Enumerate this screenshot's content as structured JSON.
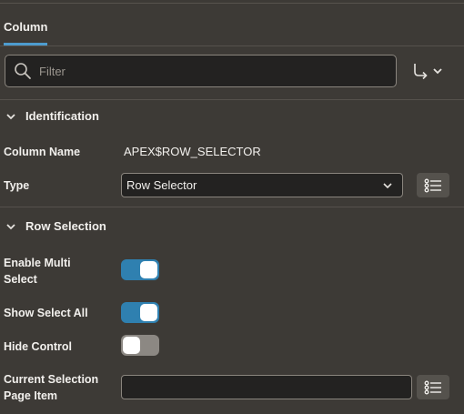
{
  "tabs": [
    {
      "label": "Column",
      "active": true
    }
  ],
  "filter": {
    "placeholder": "Filter",
    "value": ""
  },
  "sections": {
    "identification": {
      "title": "Identification",
      "column_name_label": "Column Name",
      "column_name_value": "APEX$ROW_SELECTOR",
      "type_label": "Type",
      "type_value": "Row Selector"
    },
    "row_selection": {
      "title": "Row Selection",
      "enable_multi_select": {
        "label_line1": "Enable Multi",
        "label_line2": "Select",
        "on": true
      },
      "show_select_all": {
        "label": "Show Select All",
        "on": true
      },
      "hide_control": {
        "label": "Hide Control",
        "on": false
      },
      "current_selection_page_item": {
        "label_line1": "Current Selection",
        "label_line2": "Page Item",
        "value": ""
      }
    }
  },
  "colors": {
    "accent": "#4d9ccf",
    "toggle_on": "#2f80b0",
    "toggle_off": "#8c8883",
    "background": "#3d3a36"
  }
}
